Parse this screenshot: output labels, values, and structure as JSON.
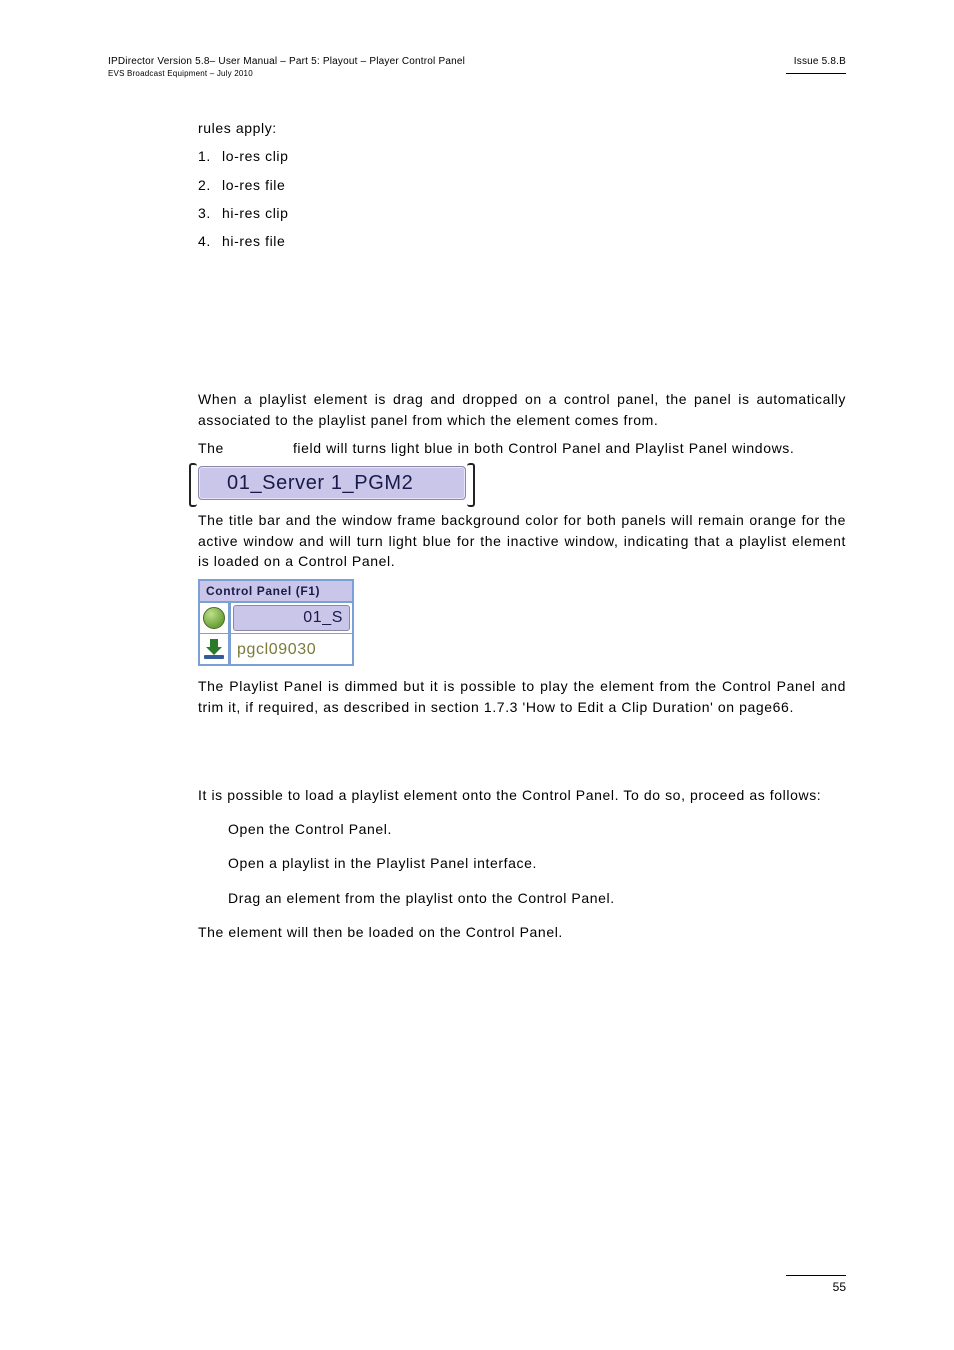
{
  "header": {
    "title": "IPDirector Version 5.8– User Manual – Part 5: Playout – Player Control Panel",
    "subtitle": "EVS Broadcast Equipment – July 2010",
    "issue": "Issue 5.8.B"
  },
  "body": {
    "rules_intro": "rules apply:",
    "rules": [
      {
        "n": "1.",
        "t": "lo-res clip"
      },
      {
        "n": "2.",
        "t": "lo-res file"
      },
      {
        "n": "3.",
        "t": "hi-res clip"
      },
      {
        "n": "4.",
        "t": "hi-res file"
      }
    ],
    "para1": "When a playlist element is drag and dropped on a control panel, the panel is automatically associated to the playlist panel from which the element comes from.",
    "para2a": "The",
    "para2b": "field will turns light blue in both Control Panel and Playlist Panel windows.",
    "channel_label": "01_Server 1_PGM2",
    "para3": "The title bar and the window frame background color for both panels will remain orange for the active window and will turn light blue for the inactive window, indicating that a playlist element is loaded on a Control Panel.",
    "panel": {
      "title": "Control Panel (F1)",
      "row1": "01_S",
      "row2": "pgcl09030"
    },
    "para4": "The Playlist Panel is dimmed but it is possible to play the element from the Control Panel and trim it, if required, as described in section 1.7.3 'How to Edit a Clip Duration' on page66.",
    "para5": "It is possible to load a playlist element onto the Control Panel. To do so, proceed as follows:",
    "steps": [
      "Open the Control Panel.",
      "Open a playlist in the Playlist Panel interface.",
      "Drag an element from the playlist onto the Control Panel."
    ],
    "para6": "The element will then be loaded on the Control Panel."
  },
  "footer": {
    "page": "55"
  }
}
